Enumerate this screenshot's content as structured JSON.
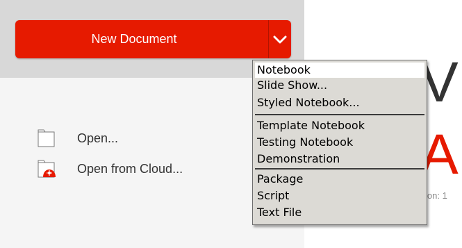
{
  "split_button": {
    "label": "New Document",
    "arrow_icon": "chevron-down-icon",
    "color": "#e61a00"
  },
  "actions": [
    {
      "label": "Open...",
      "icon": "folder-icon"
    },
    {
      "label": "Open from Cloud...",
      "icon": "cloud-folder-icon"
    }
  ],
  "dropdown": {
    "groups": [
      [
        {
          "label": "Notebook",
          "highlighted": true
        },
        {
          "label": "Slide Show..."
        },
        {
          "label": "Styled Notebook..."
        }
      ],
      [
        {
          "label": "Template Notebook"
        },
        {
          "label": "Testing Notebook"
        },
        {
          "label": "Demonstration"
        }
      ],
      [
        {
          "label": "Package"
        },
        {
          "label": "Script"
        },
        {
          "label": "Text File"
        }
      ]
    ]
  },
  "background": {
    "title_line1_fragment": "V",
    "title_line2_fragment": "A",
    "version_fragment": "ion: 1",
    "accent_color": "#e61a00"
  }
}
